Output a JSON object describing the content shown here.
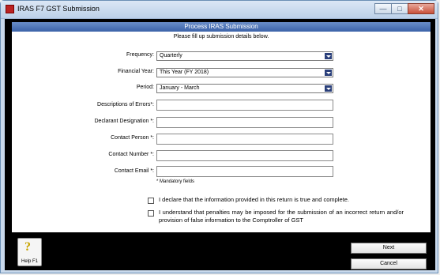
{
  "window": {
    "title": "IRAS F7 GST Submission"
  },
  "panel": {
    "header": "Process IRAS Submission",
    "subtitle": "Please fill up submission details below."
  },
  "form": {
    "frequency": {
      "label": "Frequency:",
      "value": "Quarterly"
    },
    "financial_year": {
      "label": "Financial Year:",
      "value": "This Year (FY 2018)"
    },
    "period": {
      "label": "Period:",
      "value": "January - March"
    },
    "descriptions_of_errors": {
      "label": "Descriptions of Errors*:",
      "value": ""
    },
    "declarant_designation": {
      "label": "Declarant Designation *:",
      "value": ""
    },
    "contact_person": {
      "label": "Contact Person *:",
      "value": ""
    },
    "contact_number": {
      "label": "Contact Number *:",
      "value": ""
    },
    "contact_email": {
      "label": "Contact Email *:",
      "value": ""
    },
    "mandatory_note": "* Mandatory fields"
  },
  "declarations": [
    {
      "text": "I declare that the information provided in this return is true and complete.",
      "checked": false
    },
    {
      "text": "I understand that penalties may be imposed for the submission of an incorrect return and/or provision of false information to the Comptroller of GST",
      "checked": false
    }
  ],
  "footer": {
    "help_label": "Help F1",
    "help_icon": "question-mark-icon",
    "next_label": "Next",
    "cancel_label": "Cancel"
  }
}
